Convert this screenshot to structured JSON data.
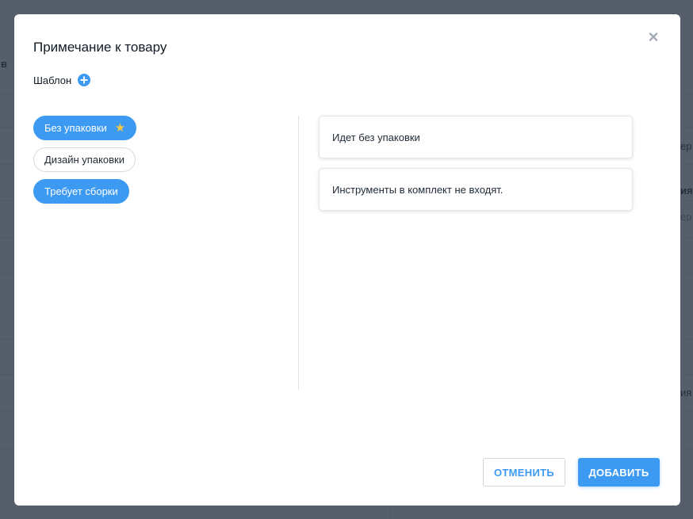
{
  "background": {
    "col_header_fragment": "в",
    "right_fragments": [
      {
        "text": "ер",
        "style": "normal"
      },
      {
        "text": "ия",
        "style": "bold"
      },
      {
        "text": "ер",
        "style": "muted"
      },
      {
        "text": "ия",
        "style": "normal"
      }
    ]
  },
  "modal": {
    "title": "Примечание к товару",
    "template_label": "Шаблон",
    "chips": [
      {
        "label": "Без упаковки",
        "active": true,
        "starred": true
      },
      {
        "label": "Дизайн упаковки",
        "active": false,
        "starred": false
      },
      {
        "label": "Требует сборки",
        "active": true,
        "starred": false
      }
    ],
    "notes": [
      "Идет без упаковки",
      "Инструменты в комплект не входят."
    ],
    "cancel_label": "ОТМЕНИТЬ",
    "add_label": "ДОБАВИТЬ"
  },
  "colors": {
    "accent": "#3d9af3",
    "star": "#f5c544",
    "overlay": "#263142"
  }
}
